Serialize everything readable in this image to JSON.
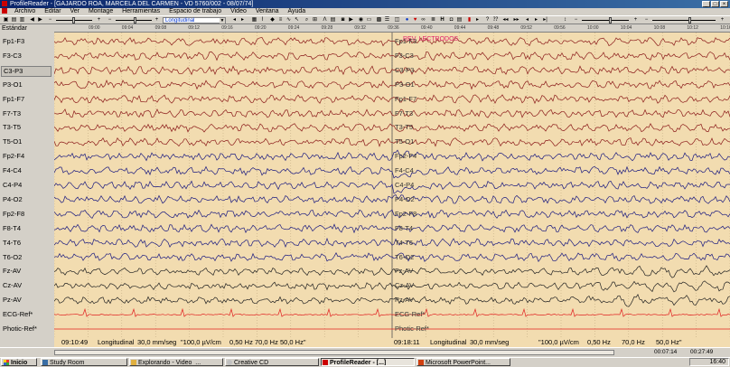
{
  "window": {
    "title": "ProfileReader - [GAJARDO ROA, MARCELA DEL CARMEN - VD 5760/002 - 08/07/74]"
  },
  "menu": [
    "Archivo",
    "Editar",
    "Ver",
    "Montage",
    "Herramientas",
    "Espacio de trabajo",
    "Video",
    "Ventana",
    "Ayuda"
  ],
  "toolbar": {
    "montage_value": "Longitudinal",
    "left_minus": "−",
    "left_plus": "+",
    "right_minus": "−",
    "right_plus": "+"
  },
  "sidebar": {
    "view_label": "Estándar"
  },
  "timeline": {
    "marks": [
      "09:00",
      "09:04",
      "09:08",
      "09:12",
      "09:16",
      "09:20",
      "09:24",
      "09:28",
      "09:32",
      "09:36",
      "09:40",
      "09:44",
      "09:48",
      "09:52",
      "09:56",
      "10:00",
      "10:04",
      "10:08",
      "10:12",
      "10:16"
    ]
  },
  "channels": [
    {
      "label": "Fp1-F3",
      "color": "#8b1a1a"
    },
    {
      "label": "F3-C3",
      "color": "#8b1a1a"
    },
    {
      "label": "C3-P3",
      "color": "#8b1a1a"
    },
    {
      "label": "P3-O1",
      "color": "#8b1a1a"
    },
    {
      "label": "Fp1-F7",
      "color": "#8b1a1a"
    },
    {
      "label": "F7-T3",
      "color": "#8b1a1a"
    },
    {
      "label": "T3-T5",
      "color": "#8b1a1a"
    },
    {
      "label": "T5-O1",
      "color": "#8b1a1a"
    },
    {
      "label": "Fp2-F4",
      "color": "#1a1a80"
    },
    {
      "label": "F4-C4",
      "color": "#1a1a80"
    },
    {
      "label": "C4-P4",
      "color": "#1a1a80"
    },
    {
      "label": "P4-O2",
      "color": "#1a1a80"
    },
    {
      "label": "Fp2-F8",
      "color": "#1a1a80"
    },
    {
      "label": "F8-T4",
      "color": "#1a1a80"
    },
    {
      "label": "T4-T6",
      "color": "#1a1a80"
    },
    {
      "label": "T6-O2",
      "color": "#1a1a80"
    },
    {
      "label": "Fz-AV",
      "color": "#222222"
    },
    {
      "label": "Cz-AV",
      "color": "#222222"
    },
    {
      "label": "Pz-AV",
      "color": "#222222"
    },
    {
      "label": "ECG-Ref*",
      "color": "#e02020"
    },
    {
      "label": "Photic-Ref*",
      "color": "#e02020"
    }
  ],
  "selected_channel": "C3-P3",
  "inline_labels": [
    "Fp1-F3",
    "F3-C3",
    "C3-P3",
    "P3-O1",
    "Fp1-F7",
    "F7-T3",
    "T3-T5",
    "T5-O1",
    "Fp2-F4",
    "F4-C4",
    "C4-P4",
    "P4-O2",
    "Fp2-F8",
    "F8-T4",
    "T4-T6",
    "T6-O2",
    "Fz-AV",
    "Cz-AV",
    "Pz-AV",
    "ECG-Ref*",
    "Photic-Ref*"
  ],
  "annotation": "REV. LECTRODOS",
  "status": {
    "left_time": "09:10:49",
    "right_time": "09:18:11",
    "montage": "Longitudinal",
    "speed": "30,0 mm/seg",
    "sensitivity": "\"100,0 µV/cm",
    "lowfilter": "0,50 Hz",
    "highfilter": "70,0 Hz",
    "notch": "50,0 Hz\""
  },
  "bottom_times": {
    "elapsed": "00:07:14",
    "total": "00:27:49"
  },
  "taskbar": {
    "start": "Inicio",
    "tasks": [
      "Study Room",
      "Explorando - Video_...",
      "Creative CD",
      "ProfileReader - [...]",
      "Microsoft PowerPoint..."
    ],
    "active": "ProfileReader - [...]",
    "clock": "16:40"
  },
  "colors": {
    "trace_bg": "#f2dcb0",
    "left_hemi": "#8b1a1a",
    "right_hemi": "#1a1a80",
    "ecg": "#e02020",
    "annotation": "#e0206a"
  }
}
